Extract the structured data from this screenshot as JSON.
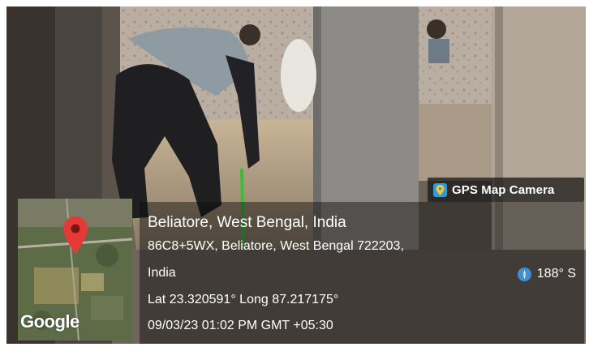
{
  "app": {
    "badge_label": "GPS Map Camera"
  },
  "map": {
    "provider_label": "Google"
  },
  "location": {
    "title": "Beliatore, West Bengal, India",
    "address_line1": "86C8+5WX, Beliatore, West Bengal 722203,",
    "address_line2": "India",
    "coordinates": "Lat 23.320591° Long 87.217175°",
    "datetime": "09/03/23 01:02 PM GMT +05:30",
    "heading": "188° S"
  },
  "colors": {
    "pin": "#e53935",
    "badge_icon": "#2f9bd8",
    "compass": "#3e8fd4"
  }
}
